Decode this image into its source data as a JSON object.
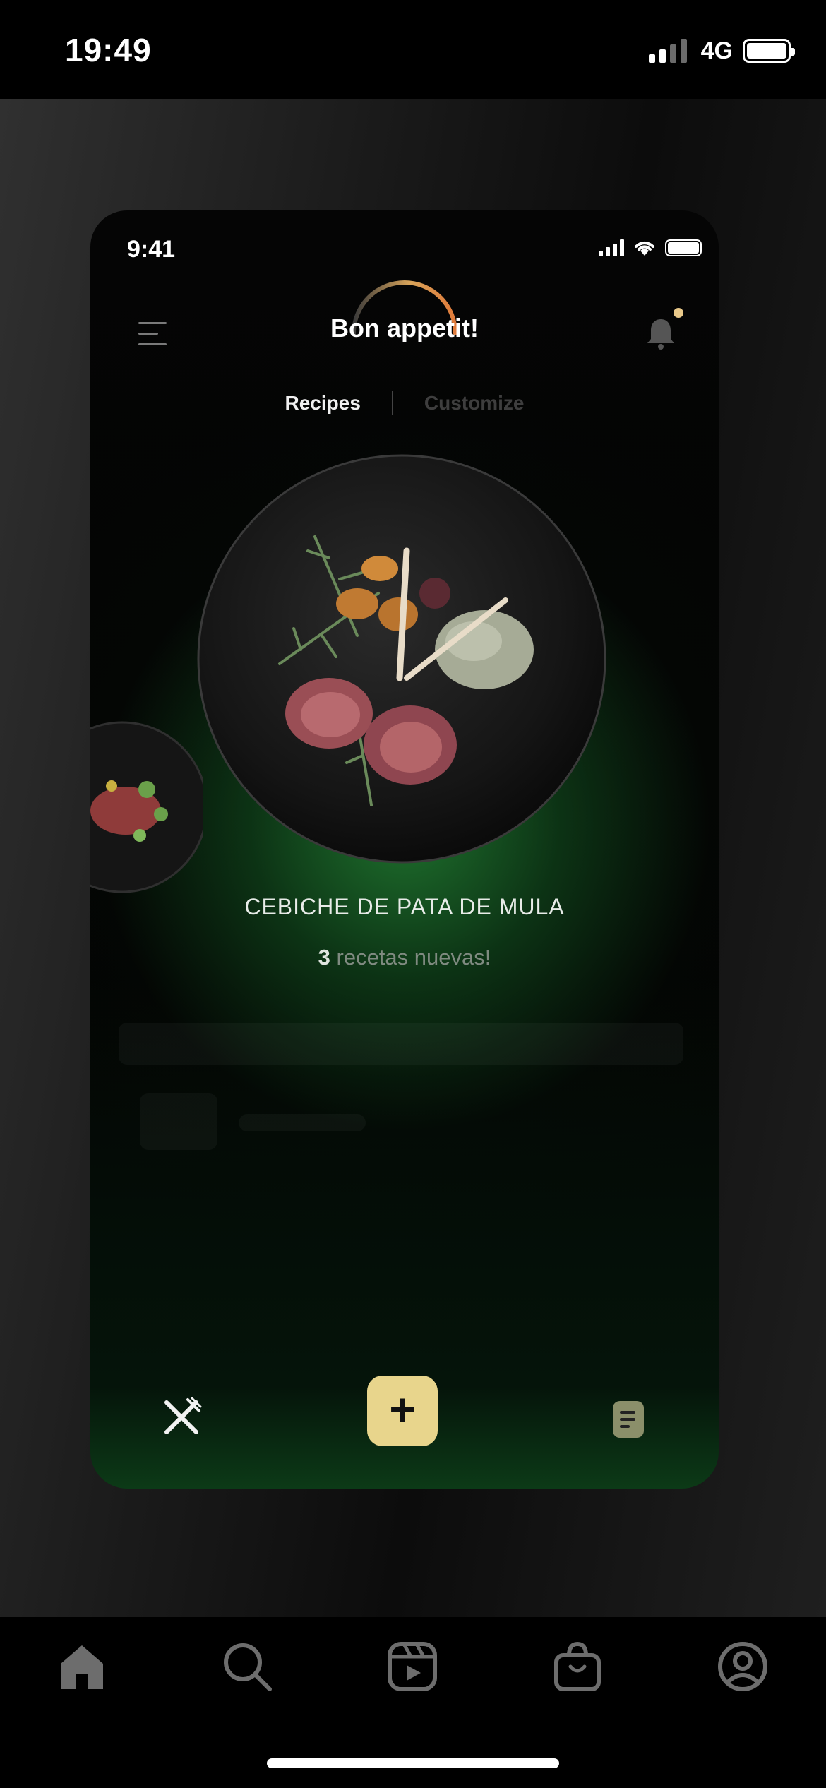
{
  "status_bar": {
    "time": "19:49",
    "network": "4G"
  },
  "app": {
    "status_time": "9:41",
    "brand": "Bon appetit!",
    "tabs": {
      "recipes": "Recipes",
      "customize": "Customize"
    },
    "dish": {
      "name": "CEBICHE DE PATA DE MULA"
    },
    "new_recipes": {
      "count": "3",
      "label": "recetas nuevas!"
    },
    "accent_color": "#e8d58c",
    "glow_color": "#2a9a3d"
  },
  "tabbar": {
    "items": [
      "home-icon",
      "search-icon",
      "reels-icon",
      "shop-icon",
      "profile-icon"
    ]
  }
}
